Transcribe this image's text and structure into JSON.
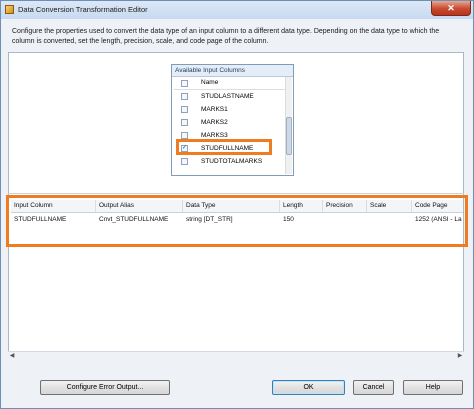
{
  "window": {
    "title": "Data Conversion Transformation Editor",
    "close_glyph": "✕"
  },
  "description": "Configure the properties used to convert the data type of an input column to a different data type. Depending on the data type to which the column is converted, set the length, precision, scale, and code page of the column.",
  "available_columns": {
    "title": "Available Input Columns",
    "header_label": "Name",
    "items": [
      {
        "label": "STUDLASTNAME",
        "checked": false
      },
      {
        "label": "MARKS1",
        "checked": false
      },
      {
        "label": "MARKS2",
        "checked": false
      },
      {
        "label": "MARKS3",
        "checked": false
      },
      {
        "label": "STUDFULLNAME",
        "checked": true
      },
      {
        "label": "STUDTOTALMARKS",
        "checked": false
      }
    ],
    "check_glyph": "✓"
  },
  "grid": {
    "columns": [
      "Input Column",
      "Output Alias",
      "Data Type",
      "Length",
      "Precision",
      "Scale",
      "Code Page"
    ],
    "rows": [
      {
        "input_column": "STUDFULLNAME",
        "output_alias": "Cnvt_STUDFULLNAME",
        "data_type": "string [DT_STR]",
        "length": "150",
        "precision": "",
        "scale": "",
        "code_page": "1252  (ANSI - La"
      }
    ]
  },
  "buttons": {
    "configure_error_output": "Configure Error Output...",
    "ok": "OK",
    "cancel": "Cancel",
    "help": "Help"
  },
  "colors": {
    "highlight": "#f07c21",
    "title_bar": "#c7daf0"
  }
}
